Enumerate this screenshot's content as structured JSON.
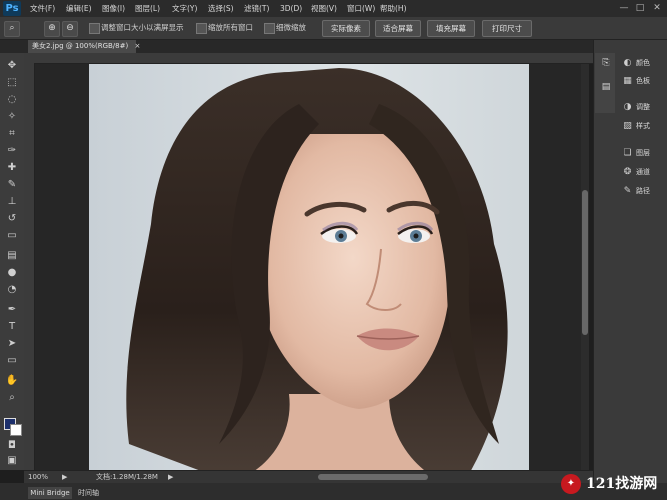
{
  "app": {
    "logo": "Ps"
  },
  "menu": [
    "文件(F)",
    "编辑(E)",
    "图像(I)",
    "图层(L)",
    "文字(Y)",
    "选择(S)",
    "滤镜(T)",
    "3D(D)",
    "视图(V)",
    "窗口(W)",
    "帮助(H)"
  ],
  "window_controls": {
    "minimize": "—",
    "maximize": "□",
    "close": "✕"
  },
  "options": {
    "resize_windows_label": "调整窗口大小以满屏显示",
    "zoom_all_label": "缩放所有窗口",
    "scrubby_zoom_label": "细微缩放",
    "actual_pixels": "实际像素",
    "fit_screen": "适合屏幕",
    "fill_screen": "填充屏幕",
    "print_size": "打印尺寸"
  },
  "document": {
    "tab_title": "美女2.jpg @ 100%(RGB/8#)",
    "tab_close": "×"
  },
  "status": {
    "zoom": "100%",
    "doc_info": "文档:1.28M/1.28M",
    "arrow": "▶"
  },
  "bottom": {
    "mini_bridge": "Mini Bridge",
    "timeline": "时间轴"
  },
  "panels": [
    {
      "icon": "palette-icon",
      "glyph": "◐",
      "label": "颜色"
    },
    {
      "icon": "swatches-icon",
      "glyph": "▦",
      "label": "色板"
    },
    {
      "icon": "adjustments-icon",
      "glyph": "◑",
      "label": "调整"
    },
    {
      "icon": "styles-icon",
      "glyph": "▨",
      "label": "样式"
    },
    {
      "icon": "layers-icon",
      "glyph": "❏",
      "label": "图层"
    },
    {
      "icon": "channels-icon",
      "glyph": "❂",
      "label": "通道"
    },
    {
      "icon": "paths-icon",
      "glyph": "✎",
      "label": "路径"
    }
  ],
  "tools": [
    "move-tool-icon",
    "marquee-tool-icon",
    "lasso-tool-icon",
    "quick-select-tool-icon",
    "crop-tool-icon",
    "eyedropper-tool-icon",
    "healing-brush-tool-icon",
    "brush-tool-icon",
    "clone-stamp-tool-icon",
    "history-brush-tool-icon",
    "eraser-tool-icon",
    "gradient-tool-icon",
    "blur-tool-icon",
    "dodge-tool-icon",
    "pen-tool-icon",
    "type-tool-icon",
    "path-select-tool-icon",
    "rectangle-tool-icon",
    "hand-tool-icon",
    "zoom-tool-icon"
  ],
  "watermark": {
    "text": "121找游网",
    "logo": "✦"
  },
  "colors": {
    "foreground": "#1c2f6b",
    "background": "#ffffff",
    "accent": "#4fb3ff"
  }
}
